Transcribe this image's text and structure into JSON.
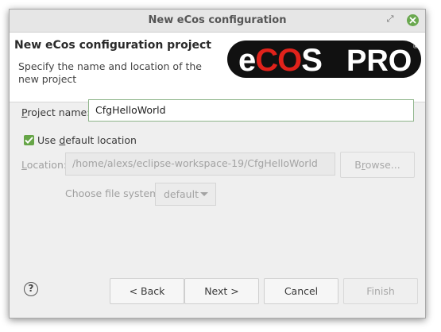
{
  "window": {
    "title": "New eCos configuration"
  },
  "header": {
    "title": "New eCos configuration project",
    "description": "Specify the name and location of the new project",
    "logo_text_left": "eCOS",
    "logo_text_right": "PRO",
    "logo_mark": "®"
  },
  "project_name": {
    "label_first": "P",
    "label_rest": "roject name:",
    "value": "CfgHelloWorld"
  },
  "default_location": {
    "label_pre": "Use ",
    "label_mnemonic": "d",
    "label_post": "efault location",
    "checked": true
  },
  "location": {
    "label_first": "L",
    "label_rest": "ocation:",
    "value": "/home/alexs/eclipse-workspace-19/CfgHelloWorld",
    "browse_pre": "B",
    "browse_mnemonic": "r",
    "browse_post": "owse..."
  },
  "file_system": {
    "label": "Choose file system:",
    "value": "default"
  },
  "buttons": {
    "back": "< Back",
    "next": "Next >",
    "cancel": "Cancel",
    "finish": "Finish"
  },
  "help": {
    "icon": "?"
  },
  "colors": {
    "accent_green": "#66a547",
    "logo_red": "#e0221b",
    "logo_black": "#111111"
  }
}
